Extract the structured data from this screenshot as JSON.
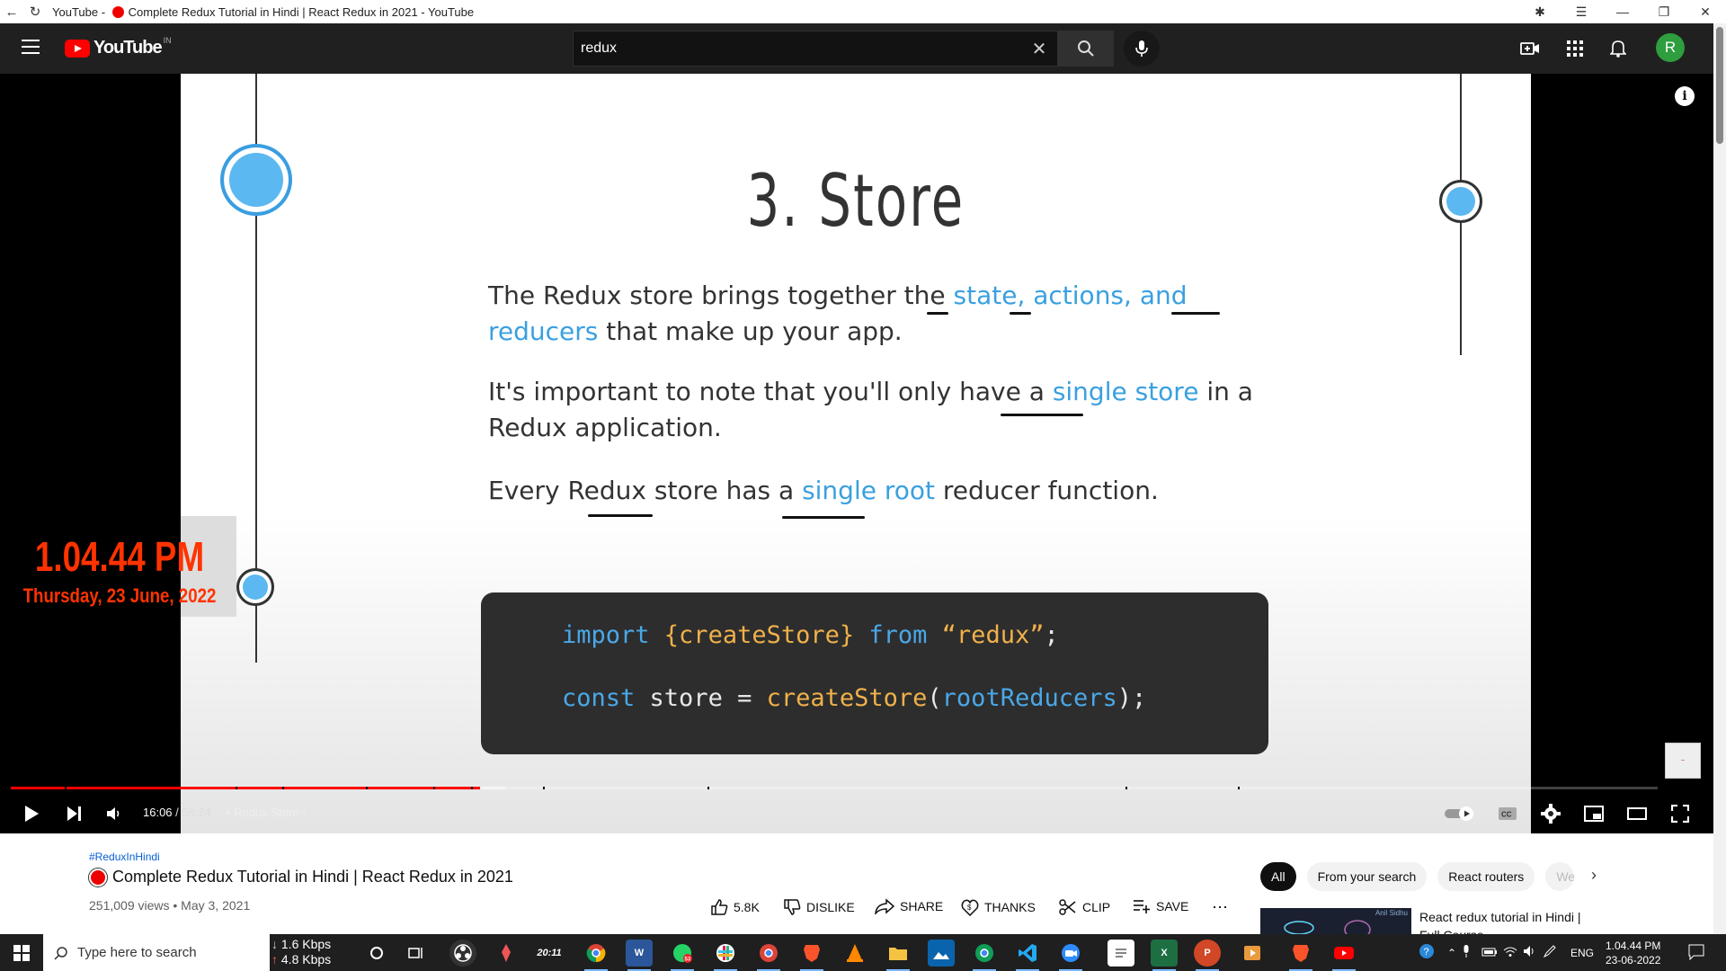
{
  "browser": {
    "title_prefix": "YouTube - ",
    "title": "Complete Redux Tutorial in Hindi | React Redux in 2021 - YouTube"
  },
  "header": {
    "logo_text": "YouTube",
    "country_code": "IN",
    "search_value": "redux",
    "avatar_letter": "R"
  },
  "slide": {
    "title": "3. Store",
    "p1_a": "The Redux store brings together the ",
    "p1_hl": "state, actions, and reducers",
    "p1_b": " that make up your app.",
    "p2_a": "It's important to note that you'll only have a ",
    "p2_hl": "single store",
    "p2_b": " in a Redux application.",
    "p3_a": "Every Redux store has a ",
    "p3_hl": "single root",
    "p3_b": " reducer function.",
    "code": {
      "l1_kw1": "import ",
      "l1_y1": "{createStore}",
      "l1_kw2": " from ",
      "l1_y2": "“redux”",
      "l1_end": ";",
      "l2_kw": "const ",
      "l2_wt1": "store = ",
      "l2_y": "createStore",
      "l2_wt2": "(",
      "l2_kw2": "rootReducers",
      "l2_end": ");"
    }
  },
  "overlay": {
    "clock_time": "1.04.44 PM",
    "clock_date": "Thursday, 23 June, 2022"
  },
  "player": {
    "current_time": "16:06",
    "duration": "56:24",
    "chapter": "Redux Store",
    "played_fraction": 0.285,
    "loaded_fraction": 0.3
  },
  "video": {
    "hashtag": "#ReduxInHindi",
    "title": "Complete Redux Tutorial in Hindi | React Redux in 2021",
    "meta": "251,009 views • May 3, 2021",
    "likes": "5.8K",
    "dislike": "DISLIKE",
    "share": "SHARE",
    "thanks": "THANKS",
    "clip": "CLIP",
    "save": "SAVE"
  },
  "chips": [
    "All",
    "From your search",
    "React routers",
    "We"
  ],
  "recommendation": {
    "title": "React redux tutorial in Hindi | Full Course",
    "thumb_text": "Anil Sidhu"
  },
  "taskbar": {
    "search_placeholder": "Type here to search",
    "net_down": "1.6 Kbps",
    "net_up": "4.8 Kbps",
    "language": "ENG",
    "time": "1.04.44 PM",
    "date": "23-06-2022",
    "whatsapp_badge": "53",
    "clock_app_text": "20:11"
  },
  "colors": {
    "accent_red": "#ff0000",
    "slide_highlight": "#3aa0e0",
    "overlay_clock": "#ff3300"
  }
}
